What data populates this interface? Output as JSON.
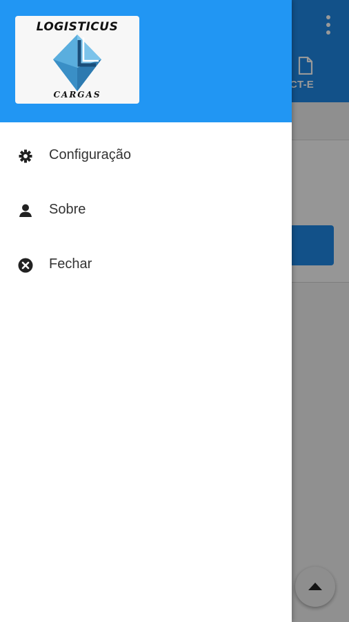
{
  "app": {
    "tab_label": "CT-E",
    "tab_icon": "document-icon",
    "overflow_icon": "more-vertical-icon",
    "scroll_top_icon": "arrow-up-icon"
  },
  "drawer": {
    "logo": {
      "top_text": "LOGISTICUS",
      "bottom_text": "CARGAS"
    },
    "menu": [
      {
        "label": "Configuração",
        "icon": "gear-icon"
      },
      {
        "label": "Sobre",
        "icon": "person-icon"
      },
      {
        "label": "Fechar",
        "icon": "close-circle-icon"
      }
    ]
  },
  "colors": {
    "header_blue": "#2196f3",
    "app_bar_blue": "#1e88e5",
    "text": "#333333"
  }
}
